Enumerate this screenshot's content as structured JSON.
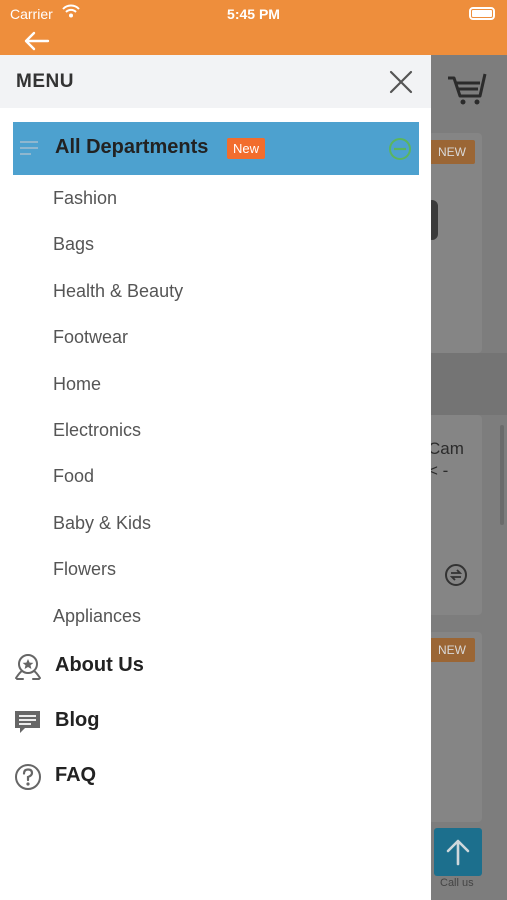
{
  "status_bar": {
    "carrier": "Carrier",
    "time": "5:45 PM"
  },
  "drawer": {
    "title": "MENU",
    "departments": {
      "label": "All Departments",
      "badge": "New",
      "items": [
        "Fashion",
        "Bags",
        "Health & Beauty",
        "Footwear",
        "Home",
        "Electronics",
        "Food",
        "Baby & Kids",
        "Flowers",
        "Appliances"
      ]
    },
    "links": [
      {
        "label": "About Us",
        "icon": "award-icon"
      },
      {
        "label": "Blog",
        "icon": "message-icon"
      },
      {
        "label": "FAQ",
        "icon": "help-icon"
      }
    ]
  },
  "background": {
    "badge_new": "NEW",
    "product_text": "Cam\n< -",
    "call_us": "Call us"
  },
  "colors": {
    "header": "#ee8e3c",
    "department_highlight": "#4da1cf",
    "new_badge": "#f26d2d"
  }
}
